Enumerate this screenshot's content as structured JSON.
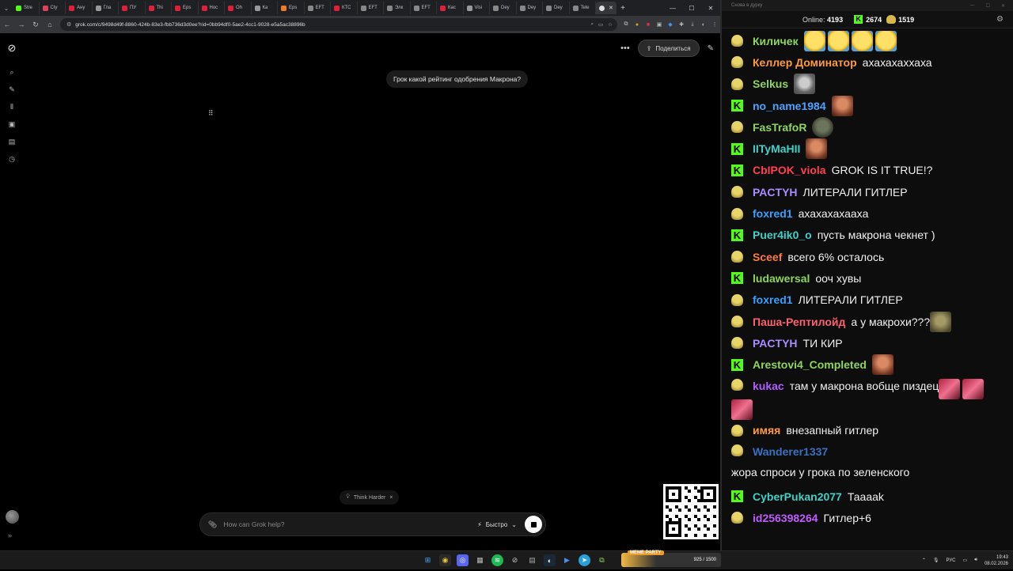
{
  "browser": {
    "tabs": [
      {
        "label": "Stre",
        "color": "#53fc18"
      },
      {
        "label": "Cty",
        "color": "#e04060"
      },
      {
        "label": "Ану",
        "color": "#e0203a"
      },
      {
        "label": "Гла",
        "color": "#999999"
      },
      {
        "label": "ПУ",
        "color": "#e0203a"
      },
      {
        "label": "Thi",
        "color": "#e0203a"
      },
      {
        "label": "Eps",
        "color": "#e0203a"
      },
      {
        "label": "Нос",
        "color": "#e0203a"
      },
      {
        "label": "Oh",
        "color": "#e0203a"
      },
      {
        "label": "Ка",
        "color": "#999999"
      },
      {
        "label": "Eps",
        "color": "#f07a2a"
      },
      {
        "label": "EFT",
        "color": "#888888"
      },
      {
        "label": "КТС",
        "color": "#e0203a"
      },
      {
        "label": "EFT",
        "color": "#888888"
      },
      {
        "label": "Элк",
        "color": "#888888"
      },
      {
        "label": "EFT",
        "color": "#888888"
      },
      {
        "label": "Кас",
        "color": "#e0203a"
      },
      {
        "label": "Visi",
        "color": "#999999"
      },
      {
        "label": "Dey",
        "color": "#888888"
      },
      {
        "label": "Dey",
        "color": "#888888"
      },
      {
        "label": "Dey",
        "color": "#888888"
      },
      {
        "label": "Tele",
        "color": "#888888"
      }
    ],
    "active_tab_close": "✕",
    "url": "grok.com/c/9498d49f-8860-424b-83e3-fbb736d3d0ee?rid=0bb94df0-5ae2-4cc1-9028-e5a5ac38896b"
  },
  "grok": {
    "share_label": "Поделиться",
    "user_message": "Грок какой рейтинг одобрения Макрона?",
    "loading_indicator": "⠿",
    "think_harder_label": "Think Harder",
    "input_placeholder": "How can Grok help?",
    "mode_label": "Быстро"
  },
  "chat": {
    "window_title": "Снова в дурку",
    "online_label": "Online:",
    "online_count": "4193",
    "kick_count": "2674",
    "twitch_count": "1519",
    "messages": [
      {
        "platform": "tw",
        "user": "Киличек",
        "color": "#8fd45c",
        "text": "",
        "emotes": [
          "e-laugh",
          "e-laugh",
          "e-laugh",
          "e-laugh"
        ]
      },
      {
        "platform": "tw",
        "user": "Келлер Доминатор",
        "color": "#ff9a3c",
        "text": "ахахахаххаха",
        "emotes": []
      },
      {
        "platform": "tw",
        "user": "Selkus",
        "color": "#8fd45c",
        "text": "",
        "emotes": [
          "e-grey"
        ]
      },
      {
        "platform": "kick",
        "user": "no_name1984",
        "color": "#4aa3ff",
        "text": "",
        "emotes": [
          "e-face"
        ]
      },
      {
        "platform": "tw",
        "user": "FasTrafoR",
        "color": "#8fd45c",
        "text": "",
        "emotes": [
          "e-dark"
        ]
      },
      {
        "platform": "kick",
        "user": "IITyMaHII",
        "color": "#3fd0c8",
        "text": "",
        "emotes": [
          "e-face"
        ]
      },
      {
        "platform": "kick",
        "user": "CbIPOK_viola",
        "color": "#ff4050",
        "text": "GROK IS IT TRUE!?",
        "emotes": []
      },
      {
        "platform": "tw",
        "user": "PACTYH",
        "color": "#a98bff",
        "text": "ЛИТЕРАЛИ ГИТЛЕР",
        "emotes": []
      },
      {
        "platform": "tw",
        "user": "foxred1",
        "color": "#3aa0ff",
        "text": "ахахахахаaxa",
        "emotes": []
      },
      {
        "platform": "kick",
        "user": "Puer4ik0_o",
        "color": "#3fd0c8",
        "text": "пусть макрона чекнет )",
        "emotes": []
      },
      {
        "platform": "tw",
        "user": "Sceef",
        "color": "#ff7a3c",
        "text": "всего 6% осталось",
        "emotes": []
      },
      {
        "platform": "kick",
        "user": "ludawersal",
        "color": "#8fd45c",
        "text": "ооч хувы",
        "emotes": []
      },
      {
        "platform": "tw",
        "user": "foxred1",
        "color": "#3aa0ff",
        "text": "ЛИТЕРАЛИ ГИТЛЕР",
        "emotes": []
      },
      {
        "platform": "tw",
        "user": "Паша-Рептилойд",
        "color": "#ff6070",
        "text": "а у макрохи???",
        "emotes": [
          "e-gold"
        ]
      },
      {
        "platform": "tw",
        "user": "PACTYH",
        "color": "#a98bff",
        "text": "ТИ КИР",
        "emotes": []
      },
      {
        "platform": "kick",
        "user": "Arestovi4_Completed",
        "color": "#8fd45c",
        "text": "",
        "emotes": [
          "e-face"
        ]
      },
      {
        "platform": "tw",
        "user": "kukac",
        "color": "#b05cff",
        "text": "там у макрона вобще пиздец",
        "emotes": [
          "e-red",
          "e-red",
          "e-red"
        ],
        "tall": true
      },
      {
        "platform": "tw",
        "user": "имяя",
        "color": "#ff9a3c",
        "text": "внезапный гитлер",
        "emotes": []
      },
      {
        "platform": "tw",
        "user": "Wanderer1337",
        "color": "#3a70c0",
        "text": "жора спроси у грока по зеленского",
        "emotes": [],
        "tall": true
      },
      {
        "platform": "kick",
        "user": "CyberPukan2077",
        "color": "#3fd0c8",
        "text": "Тааaak",
        "emotes": []
      },
      {
        "platform": "tw",
        "user": "id256398264",
        "color": "#c05cff",
        "text": "Гитлер+6",
        "emotes": []
      }
    ]
  },
  "taskbar": {
    "widget_tag": "MEME PARTY",
    "widget_value": "925 / 1500",
    "lang": "РУС",
    "time": "19:43",
    "date": "08.02.2026"
  }
}
